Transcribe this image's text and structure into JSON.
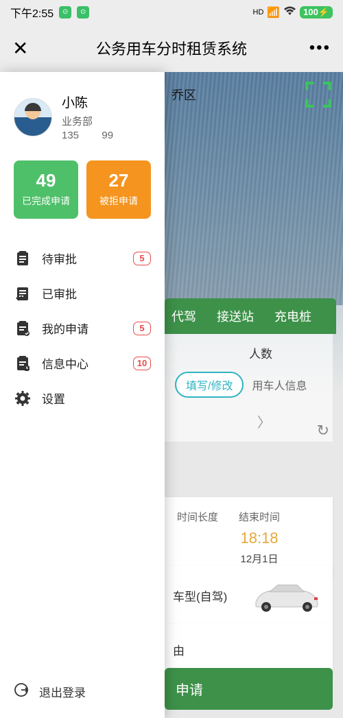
{
  "status": {
    "time": "下午2:55",
    "hd": "HD",
    "battery": "100"
  },
  "title": "公务用车分时租赁系统",
  "bg": {
    "region_suffix": "乔区"
  },
  "tabs": {
    "t1": "代驾",
    "t2": "接送站",
    "t3": "充电桩"
  },
  "form": {
    "people_label": "人数",
    "fill_label": "填写/修改",
    "user_info": "用车人信息"
  },
  "time_card": {
    "duration_label": "时间长度",
    "end_label": "结束时间",
    "end_time": "18:18",
    "end_date": "12月1日"
  },
  "car": {
    "type_label": "车型(自驾)"
  },
  "reason": {
    "label": "由"
  },
  "apply_btn": "申请",
  "sidebar": {
    "user": {
      "name": "小陈",
      "dept": "业务部",
      "phone_a": "135",
      "phone_b": "99"
    },
    "stats": {
      "completed": {
        "count": "49",
        "label": "已完成申请"
      },
      "rejected": {
        "count": "27",
        "label": "被拒申请"
      }
    },
    "menu": {
      "pending": {
        "label": "待审批",
        "badge": "5"
      },
      "approved": {
        "label": "已审批"
      },
      "my_apply": {
        "label": "我的申请",
        "badge": "5"
      },
      "info": {
        "label": "信息中心",
        "badge": "10"
      },
      "settings": {
        "label": "设置"
      }
    },
    "logout": "退出登录"
  }
}
